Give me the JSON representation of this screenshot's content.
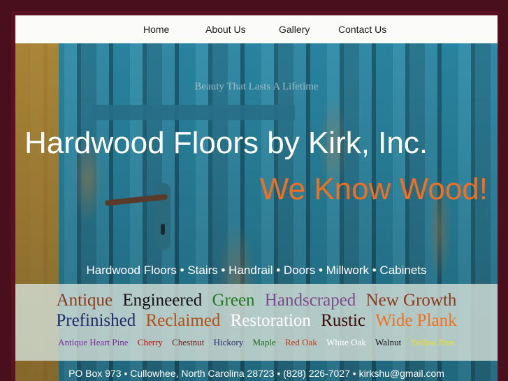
{
  "nav": {
    "items": [
      "Home",
      "About Us",
      "Gallery",
      "Contact Us"
    ]
  },
  "hero": {
    "tagline": "Beauty That Lasts A Lifetime",
    "title": "Hardwood Floors by Kirk, Inc.",
    "slogan": "We Know Wood!",
    "services": "Hardwood Floors • Stairs • Handrail • Doors • Millwork • Cabinets"
  },
  "keywords": {
    "row1": [
      {
        "text": "Antique",
        "color": "#8a3a1a"
      },
      {
        "text": "Engineered",
        "color": "#111111"
      },
      {
        "text": "Green",
        "color": "#1f7a1f"
      },
      {
        "text": "Handscraped",
        "color": "#7a4a8a"
      },
      {
        "text": "New Growth",
        "color": "#8a3a1a"
      }
    ],
    "row2": [
      {
        "text": "Prefinished",
        "color": "#1f2a6a"
      },
      {
        "text": "Reclaimed",
        "color": "#b0501a"
      },
      {
        "text": "Restoration",
        "color": "#ffffff"
      },
      {
        "text": "Rustic",
        "color": "#3a0a0a"
      },
      {
        "text": "Wide Plank",
        "color": "#f07020"
      }
    ],
    "row3": [
      {
        "text": "Antique Heart Pine",
        "color": "#7a2a9a"
      },
      {
        "text": "Cherry",
        "color": "#c01010"
      },
      {
        "text": "Chestnut",
        "color": "#6a1a1a"
      },
      {
        "text": "Hickory",
        "color": "#2a2a6a"
      },
      {
        "text": "Maple",
        "color": "#1a6a1a"
      },
      {
        "text": "Red Oak",
        "color": "#c03a1a"
      },
      {
        "text": "White Oak",
        "color": "#ffffff"
      },
      {
        "text": "Walnut",
        "color": "#111111"
      },
      {
        "text": "Yellow Pine",
        "color": "#e8e020"
      }
    ]
  },
  "footer": {
    "contact": "PO Box 973 • Cullowhee, North Carolina  28723 • (828) 226-7027 • kirkshu@gmail.com"
  }
}
